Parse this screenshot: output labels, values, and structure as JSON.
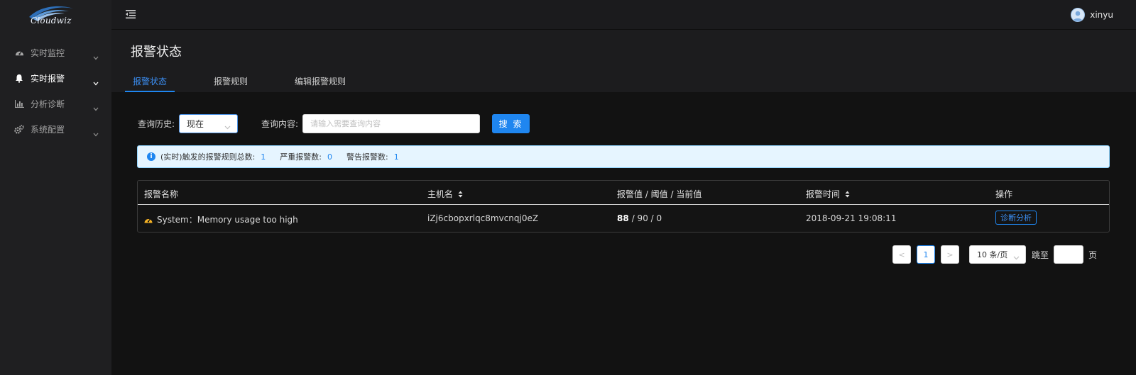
{
  "brand": {
    "logo_text": "Cloudwiz",
    "logo_color": "#2e6fb8"
  },
  "sidebar": {
    "items": [
      {
        "label": "实时监控",
        "icon": "dashboard-icon"
      },
      {
        "label": "实时报警",
        "icon": "bell-icon"
      },
      {
        "label": "分析诊断",
        "icon": "bar-chart-icon"
      },
      {
        "label": "系统配置",
        "icon": "gears-icon"
      }
    ]
  },
  "header": {
    "username": "xinyu"
  },
  "page": {
    "title": "报警状态",
    "tabs": [
      {
        "label": "报警状态",
        "active": true
      },
      {
        "label": "报警规则",
        "active": false
      },
      {
        "label": "编辑报警规则",
        "active": false
      }
    ]
  },
  "filters": {
    "history_label": "查询历史:",
    "history_value": "现在",
    "query_label": "查询内容:",
    "query_placeholder": "请输入需要查询内容",
    "search_label": "搜 索"
  },
  "summary": {
    "total_label": "(实时)触发的报警规则总数:",
    "total_value": "1",
    "critical_label": "严重报警数:",
    "critical_value": "0",
    "warning_label": "警告报警数:",
    "warning_value": "1"
  },
  "table": {
    "columns": [
      "报警名称",
      "主机名",
      "报警值 / 阈值 / 当前值",
      "报警时间",
      "操作"
    ],
    "rows": [
      {
        "name": "System：Memory usage too high",
        "host": "iZj6cbopxrlqc8mvcnqj0eZ",
        "alarm_value": "88",
        "threshold_current": "/ 90 / 0",
        "time": "2018-09-21 19:08:11",
        "action": "诊断分析"
      }
    ]
  },
  "pagination": {
    "prev": "<",
    "current_page": "1",
    "next": ">",
    "page_size": "10 条/页",
    "jump_label": "跳至",
    "page_suffix": "页"
  },
  "colors": {
    "primary": "#1f86f0",
    "alert_bg": "#e6f5ff",
    "sidebar_bg": "#1f1f21",
    "content_bg": "#121212"
  }
}
